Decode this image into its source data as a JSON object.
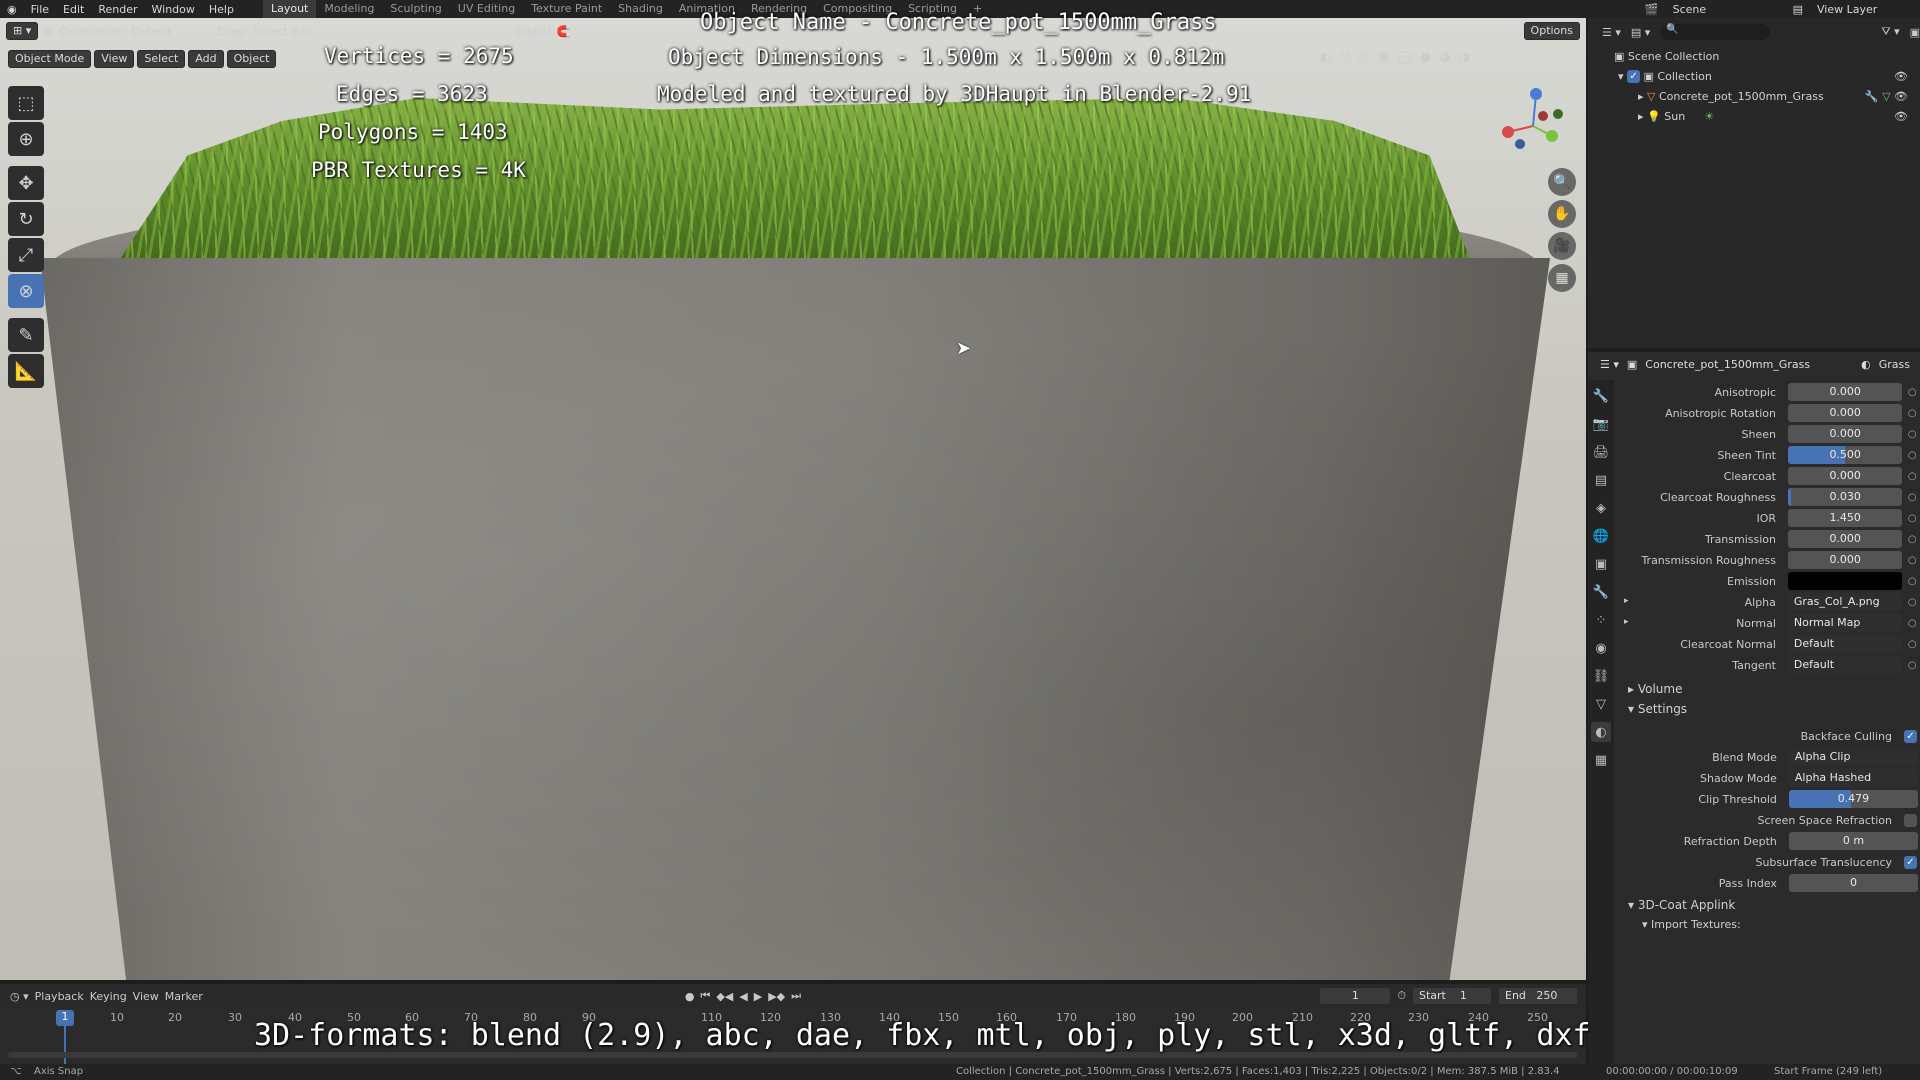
{
  "topbar": {
    "menus": [
      "File",
      "Edit",
      "Render",
      "Window",
      "Help"
    ],
    "workspaces": [
      "Layout",
      "Modeling",
      "Sculpting",
      "UV Editing",
      "Texture Paint",
      "Shading",
      "Animation",
      "Rendering",
      "Compositing",
      "Scripting"
    ],
    "active_workspace": "Layout",
    "scene": "Scene",
    "view_layer": "View Layer"
  },
  "viewport_header": {
    "orientation_label": "Orientation:",
    "orientation_value": "Default",
    "drag_label": "Drag:",
    "drag_value": "Select Box",
    "transform": "Global",
    "options": "Options",
    "mode": "Object Mode",
    "view": "View",
    "select": "Select",
    "add": "Add",
    "object": "Object"
  },
  "overlay": {
    "object_name": "Object Name - Concrete_pot_1500mm_Grass",
    "dimensions": "Object Dimensions -  1.500m x 1.500m x 0.812m",
    "credit": "Modeled and textured by 3DHaupt in Blender-2.91",
    "vertices": "Vertices = 2675",
    "edges": "Edges = 3623",
    "polygons": "Polygons = 1403",
    "textures": "PBR Textures = 4K",
    "formats": "3D-formats: blend (2.9), abc, dae, fbx, mtl, obj, ply, stl, x3d, gltf, dxf"
  },
  "outliner": {
    "scene_collection": "Scene Collection",
    "collection": "Collection",
    "object": "Concrete_pot_1500mm_Grass",
    "sun": "Sun"
  },
  "properties": {
    "object_name": "Concrete_pot_1500mm_Grass",
    "material": "Grass",
    "rows": [
      {
        "label": "Anisotropic",
        "value": "0.000"
      },
      {
        "label": "Anisotropic Rotation",
        "value": "0.000"
      },
      {
        "label": "Sheen",
        "value": "0.000"
      },
      {
        "label": "Sheen Tint",
        "value": "0.500"
      },
      {
        "label": "Clearcoat",
        "value": "0.000"
      },
      {
        "label": "Clearcoat Roughness",
        "value": "0.030"
      },
      {
        "label": "IOR",
        "value": "1.450"
      },
      {
        "label": "Transmission",
        "value": "0.000"
      },
      {
        "label": "Transmission Roughness",
        "value": "0.000"
      },
      {
        "label": "Emission",
        "value": ""
      },
      {
        "label": "Alpha",
        "value": "Gras_Col_A.png"
      },
      {
        "label": "Normal",
        "value": "Normal Map"
      },
      {
        "label": "Clearcoat Normal",
        "value": "Default"
      },
      {
        "label": "Tangent",
        "value": "Default"
      }
    ],
    "sheen_tint_fill": 0.5,
    "clearcoat_roughness_fill": 0.03,
    "volume": "Volume",
    "settings": "Settings",
    "backface_culling": "Backface Culling",
    "blend_mode_label": "Blend Mode",
    "blend_mode": "Alpha Clip",
    "shadow_mode_label": "Shadow Mode",
    "shadow_mode": "Alpha Hashed",
    "clip_threshold_label": "Clip Threshold",
    "clip_threshold": "0.479",
    "clip_threshold_fill": 0.479,
    "ssr_label": "Screen Space Refraction",
    "refraction_depth_label": "Refraction Depth",
    "refraction_depth": "0 m",
    "sss_label": "Subsurface Translucency",
    "pass_index_label": "Pass Index",
    "pass_index": "0",
    "applink": "3D-Coat Applink",
    "import_textures": "Import Textures:"
  },
  "timeline": {
    "playback": "Playback",
    "keying": "Keying",
    "view": "View",
    "marker": "Marker",
    "current_frame": "1",
    "start_label": "Start",
    "start": "1",
    "end_label": "End",
    "end": "250",
    "ticks": [
      "1",
      "10",
      "20",
      "30",
      "40",
      "50",
      "60",
      "70",
      "80",
      "90",
      "110",
      "120",
      "130",
      "140",
      "150",
      "160",
      "170",
      "180",
      "190",
      "200",
      "210",
      "220",
      "230",
      "240",
      "250"
    ]
  },
  "statusbar": {
    "left": "Axis Snap",
    "middle": "Collection | Concrete_pot_1500mm_Grass | Verts:2,675 | Faces:1,403 | Tris:2,225 | Objects:0/2 | Mem: 387.5 MiB | 2.83.4",
    "time": "00:00:00:00 / 00:00:10:09",
    "frame": "Start Frame (249 left)"
  }
}
